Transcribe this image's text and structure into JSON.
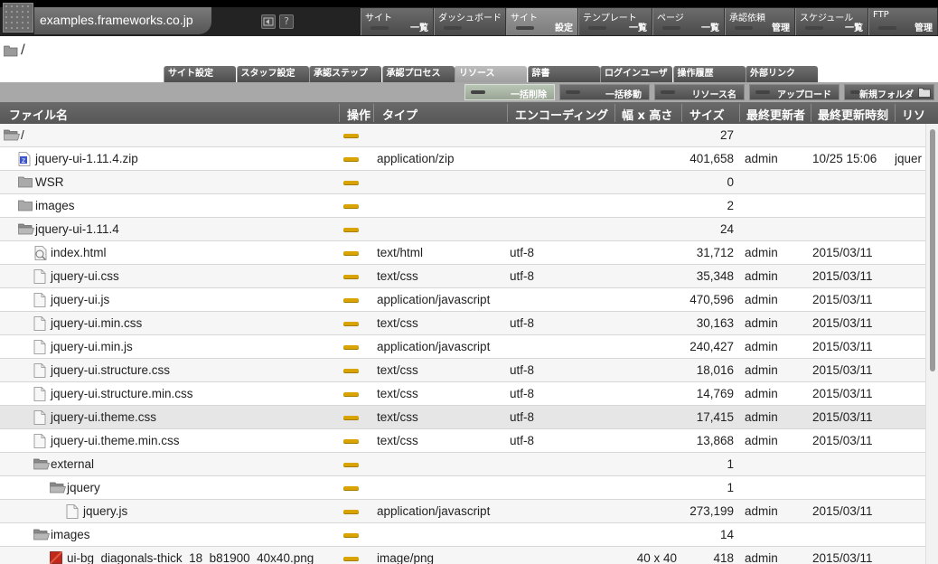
{
  "header": {
    "site_title": "examples.frameworks.co.jp",
    "icons": [
      "back-icon",
      "help-icon"
    ],
    "help_glyph": "?"
  },
  "menu": [
    {
      "top": "サイト",
      "bottom": "一覧",
      "active": false
    },
    {
      "top": "ダッシュボード",
      "bottom": "",
      "active": false
    },
    {
      "top": "サイト",
      "bottom": "設定",
      "active": true
    },
    {
      "top": "テンプレート",
      "bottom": "一覧",
      "active": false
    },
    {
      "top": "ページ",
      "bottom": "一覧",
      "active": false
    },
    {
      "top": "承認依頼",
      "bottom": "管理",
      "active": false
    },
    {
      "top": "スケジュール",
      "bottom": "一覧",
      "active": false
    },
    {
      "top": "FTP",
      "bottom": "管理",
      "active": false
    }
  ],
  "path": "/",
  "tabs": [
    {
      "label": "サイト設定",
      "active": false
    },
    {
      "label": "スタッフ設定",
      "active": false
    },
    {
      "label": "承認ステップ",
      "active": false
    },
    {
      "label": "承認プロセス",
      "active": false
    },
    {
      "label": "リソース",
      "active": true
    },
    {
      "label": "辞書",
      "active": false
    },
    {
      "label": "ログインユーザ",
      "active": false
    },
    {
      "label": "操作履歴",
      "active": false
    },
    {
      "label": "外部リンク",
      "active": false
    }
  ],
  "actions": [
    {
      "label": "一括削除",
      "active": true
    },
    {
      "label": "一括移動",
      "active": false
    },
    {
      "label": "リソース名",
      "active": false
    },
    {
      "label": "アップロード",
      "active": false
    },
    {
      "label": "新規フォルダ",
      "active": false
    }
  ],
  "columns": {
    "name": "ファイル名",
    "op": "操作",
    "type": "タイプ",
    "encoding": "エンコーディング",
    "dims": "幅 x 高さ",
    "size": "サイズ",
    "user": "最終更新者",
    "time": "最終更新時刻",
    "resource": "リソ"
  },
  "rows": [
    {
      "indent": 0,
      "icon": "folder-open-icon",
      "name": "/",
      "type": "",
      "encoding": "",
      "dims": "",
      "size": "27",
      "user": "",
      "time": "",
      "resource": ""
    },
    {
      "indent": 1,
      "icon": "zip-file-icon",
      "name": "jquery-ui-1.11.4.zip",
      "type": "application/zip",
      "encoding": "",
      "dims": "",
      "size": "401,658",
      "user": "admin",
      "time": "10/25 15:06",
      "resource": "jquer"
    },
    {
      "indent": 1,
      "icon": "folder-icon",
      "name": "WSR",
      "type": "",
      "encoding": "",
      "dims": "",
      "size": "0",
      "user": "",
      "time": "",
      "resource": ""
    },
    {
      "indent": 1,
      "icon": "folder-icon",
      "name": "images",
      "type": "",
      "encoding": "",
      "dims": "",
      "size": "2",
      "user": "",
      "time": "",
      "resource": ""
    },
    {
      "indent": 1,
      "icon": "folder-open-icon",
      "name": "jquery-ui-1.11.4",
      "type": "",
      "encoding": "",
      "dims": "",
      "size": "24",
      "user": "",
      "time": "",
      "resource": ""
    },
    {
      "indent": 2,
      "icon": "html-file-icon",
      "name": "index.html",
      "type": "text/html",
      "encoding": "utf-8",
      "dims": "",
      "size": "31,712",
      "user": "admin",
      "time": "2015/03/11",
      "resource": ""
    },
    {
      "indent": 2,
      "icon": "file-icon",
      "name": "jquery-ui.css",
      "type": "text/css",
      "encoding": "utf-8",
      "dims": "",
      "size": "35,348",
      "user": "admin",
      "time": "2015/03/11",
      "resource": ""
    },
    {
      "indent": 2,
      "icon": "file-icon",
      "name": "jquery-ui.js",
      "type": "application/javascript",
      "encoding": "",
      "dims": "",
      "size": "470,596",
      "user": "admin",
      "time": "2015/03/11",
      "resource": ""
    },
    {
      "indent": 2,
      "icon": "file-icon",
      "name": "jquery-ui.min.css",
      "type": "text/css",
      "encoding": "utf-8",
      "dims": "",
      "size": "30,163",
      "user": "admin",
      "time": "2015/03/11",
      "resource": ""
    },
    {
      "indent": 2,
      "icon": "file-icon",
      "name": "jquery-ui.min.js",
      "type": "application/javascript",
      "encoding": "",
      "dims": "",
      "size": "240,427",
      "user": "admin",
      "time": "2015/03/11",
      "resource": ""
    },
    {
      "indent": 2,
      "icon": "file-icon",
      "name": "jquery-ui.structure.css",
      "type": "text/css",
      "encoding": "utf-8",
      "dims": "",
      "size": "18,016",
      "user": "admin",
      "time": "2015/03/11",
      "resource": ""
    },
    {
      "indent": 2,
      "icon": "file-icon",
      "name": "jquery-ui.structure.min.css",
      "type": "text/css",
      "encoding": "utf-8",
      "dims": "",
      "size": "14,769",
      "user": "admin",
      "time": "2015/03/11",
      "resource": ""
    },
    {
      "indent": 2,
      "icon": "file-icon",
      "name": "jquery-ui.theme.css",
      "type": "text/css",
      "encoding": "utf-8",
      "dims": "",
      "size": "17,415",
      "user": "admin",
      "time": "2015/03/11",
      "resource": "",
      "highlight": true
    },
    {
      "indent": 2,
      "icon": "file-icon",
      "name": "jquery-ui.theme.min.css",
      "type": "text/css",
      "encoding": "utf-8",
      "dims": "",
      "size": "13,868",
      "user": "admin",
      "time": "2015/03/11",
      "resource": ""
    },
    {
      "indent": 2,
      "icon": "folder-open-icon",
      "name": "external",
      "type": "",
      "encoding": "",
      "dims": "",
      "size": "1",
      "user": "",
      "time": "",
      "resource": ""
    },
    {
      "indent": 3,
      "icon": "folder-open-icon",
      "name": "jquery",
      "type": "",
      "encoding": "",
      "dims": "",
      "size": "1",
      "user": "",
      "time": "",
      "resource": ""
    },
    {
      "indent": 4,
      "icon": "file-icon",
      "name": "jquery.js",
      "type": "application/javascript",
      "encoding": "",
      "dims": "",
      "size": "273,199",
      "user": "admin",
      "time": "2015/03/11",
      "resource": ""
    },
    {
      "indent": 2,
      "icon": "folder-open-icon",
      "name": "images",
      "type": "",
      "encoding": "",
      "dims": "",
      "size": "14",
      "user": "",
      "time": "",
      "resource": ""
    },
    {
      "indent": 3,
      "icon": "image-file-icon",
      "name": "ui-bg_diagonals-thick_18_b81900_40x40.png",
      "type": "image/png",
      "encoding": "",
      "dims": "40 x 40",
      "size": "418",
      "user": "admin",
      "time": "2015/03/11",
      "resource": ""
    }
  ],
  "colors": {
    "topbar": "#232323",
    "op_dash": "#d9a400",
    "image_icon": "#c0281c"
  }
}
